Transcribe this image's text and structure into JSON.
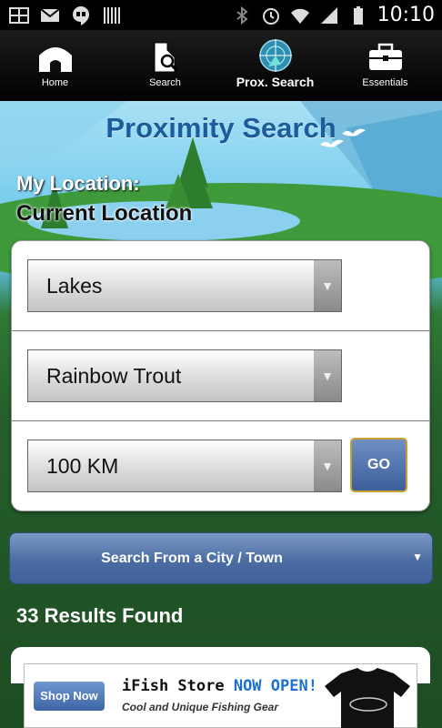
{
  "status_bar": {
    "time": "10:10",
    "left_icons": [
      "gallery-icon",
      "gmail-icon",
      "hangouts-icon",
      "barcode-icon"
    ],
    "right_icons": [
      "bluetooth-icon",
      "alarm-icon",
      "wifi-icon",
      "signal-icon",
      "battery-icon"
    ]
  },
  "nav": {
    "items": [
      {
        "label": "Home",
        "icon": "home-icon"
      },
      {
        "label": "Search",
        "icon": "map-search-icon"
      },
      {
        "label": "Prox. Search",
        "icon": "target-icon"
      },
      {
        "label": "Essentials",
        "icon": "toolbox-icon"
      }
    ],
    "active_index": 2
  },
  "page": {
    "title": "Proximity Search",
    "location_label": "My Location:",
    "location_value": "Current Location"
  },
  "form": {
    "water_type": "Lakes",
    "species": "Rainbow Trout",
    "distance": "100 KM",
    "go_label": "GO",
    "city_button": "Search From a City / Town"
  },
  "results": {
    "text": "33 Results Found"
  },
  "ad": {
    "shop_button": "Shop Now",
    "title_prefix": "iFish Store ",
    "title_highlight": "NOW OPEN!",
    "subtitle": "Cool and Unique Fishing Gear"
  },
  "colors": {
    "title_blue": "#1e5b9b",
    "button_blue": "#4b6da3",
    "go_border": "#c8a030",
    "grass_green": "#2f7a36"
  }
}
